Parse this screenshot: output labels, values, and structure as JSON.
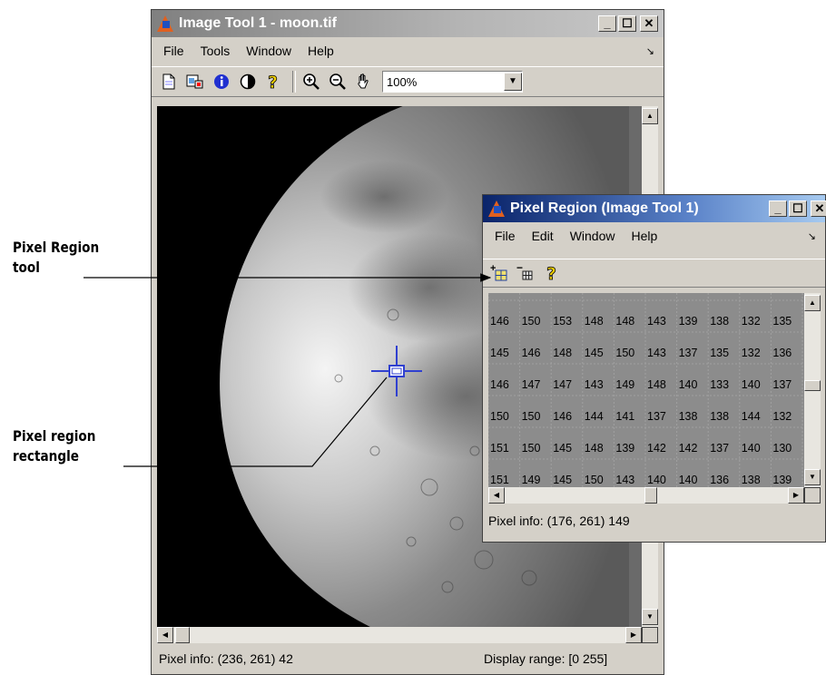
{
  "main_window": {
    "title": "Image Tool 1 - moon.tif",
    "menus": [
      "File",
      "Tools",
      "Window",
      "Help"
    ],
    "zoom_value": "100%",
    "status_pixel_info": "Pixel info: (236, 261)  42",
    "status_display_range": "Display range: [0 255]"
  },
  "pixel_region_window": {
    "title": "Pixel Region (Image Tool 1)",
    "menus": [
      "File",
      "Edit",
      "Window",
      "Help"
    ],
    "rows": [
      [
        "146",
        "150",
        "153",
        "148",
        "148",
        "143",
        "139",
        "138",
        "132",
        "135"
      ],
      [
        "145",
        "146",
        "148",
        "145",
        "150",
        "143",
        "137",
        "135",
        "132",
        "136"
      ],
      [
        "146",
        "147",
        "147",
        "143",
        "149",
        "148",
        "140",
        "133",
        "140",
        "137"
      ],
      [
        "150",
        "150",
        "146",
        "144",
        "141",
        "137",
        "138",
        "138",
        "144",
        "132"
      ],
      [
        "151",
        "150",
        "145",
        "148",
        "139",
        "142",
        "142",
        "137",
        "140",
        "130"
      ],
      [
        "151",
        "149",
        "145",
        "150",
        "143",
        "140",
        "140",
        "136",
        "138",
        "139"
      ]
    ],
    "status_pixel_info": "Pixel info: (176, 261)  149"
  },
  "annotations": {
    "pixel_region_tool": [
      "Pixel Region",
      "tool"
    ],
    "pixel_region_rectangle": [
      "Pixel region",
      "rectangle"
    ]
  },
  "colors": {
    "active_title": "#0a246a",
    "inactive_title": "#808080",
    "chrome": "#d4d0c8",
    "crosshair": "#3040d0"
  }
}
